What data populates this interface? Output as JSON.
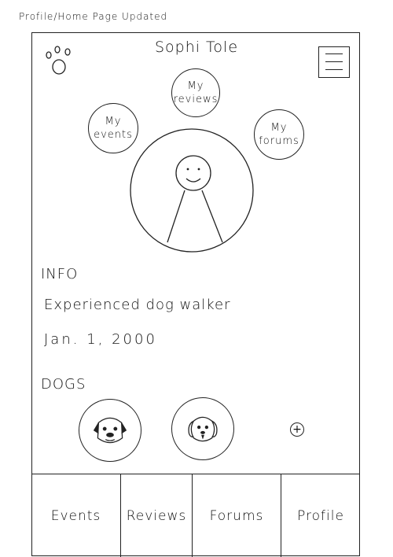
{
  "caption": "Profile/Home Page Updated",
  "header": {
    "name": "Sophi Tole",
    "logo_icon": "paw-icon",
    "menu_icon": "hamburger-menu-icon"
  },
  "bubbles": {
    "events": "My\nevents",
    "reviews": "My\nreviews",
    "forums": "My\nforums"
  },
  "info": {
    "heading": "INFO",
    "bio": "Experienced dog walker",
    "date": "Jan. 1, 2000"
  },
  "dogs": {
    "heading": "DOGS",
    "items": [
      "pug-dog-icon",
      "fluffy-dog-icon"
    ],
    "add_icon": "plus-icon",
    "add_symbol": "+"
  },
  "nav": {
    "tabs": [
      "Events",
      "Reviews",
      "Forums",
      "Profile"
    ]
  }
}
